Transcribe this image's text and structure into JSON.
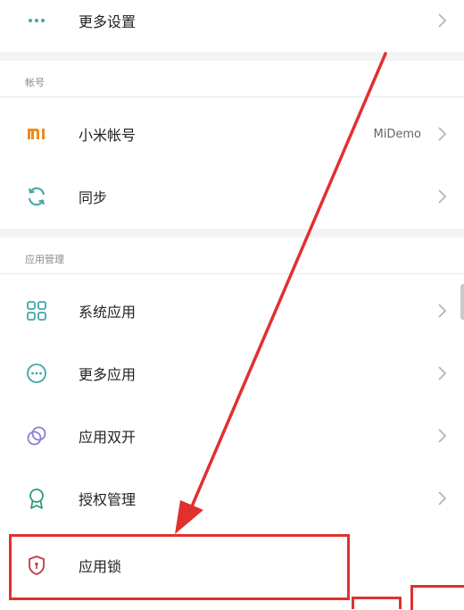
{
  "rows": {
    "more_settings": {
      "label": "更多设置"
    },
    "mi_account": {
      "label": "小米帐号",
      "value": "MiDemo"
    },
    "sync": {
      "label": "同步"
    },
    "system_apps": {
      "label": "系统应用"
    },
    "more_apps": {
      "label": "更多应用"
    },
    "dual_apps": {
      "label": "应用双开"
    },
    "permissions": {
      "label": "授权管理"
    },
    "app_lock": {
      "label": "应用锁"
    }
  },
  "sections": {
    "account": {
      "title": "帐号"
    },
    "app_management": {
      "title": "应用管理"
    }
  },
  "colors": {
    "accent_teal": "#3fa7a7",
    "mi_orange": "#f18a1c",
    "annotation_red": "#e0312f",
    "lock_shield": "#c0394a",
    "dual_purple": "#8a7fd0",
    "permissions_green": "#2f9b78"
  },
  "icons": {
    "more_settings": "three-dots-icon",
    "mi_account": "mi-logo-icon",
    "sync": "sync-icon",
    "system_apps": "grid-icon",
    "more_apps": "dots-circle-icon",
    "dual_apps": "dual-rings-icon",
    "permissions": "award-ribbon-icon",
    "app_lock": "shield-lock-icon"
  }
}
